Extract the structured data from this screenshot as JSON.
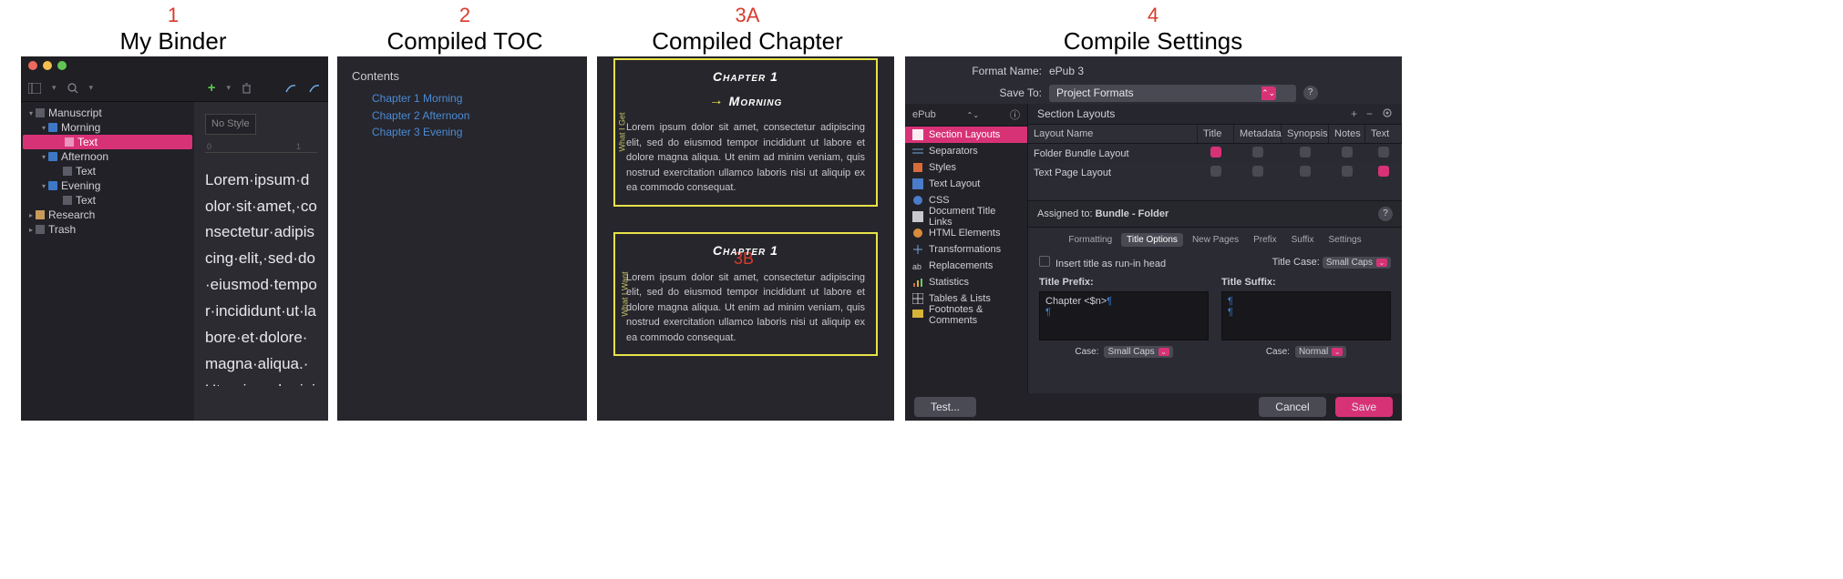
{
  "labels": {
    "l1_num": "1",
    "l1_txt": "My Binder",
    "l2_num": "2",
    "l2_txt": "Compiled TOC",
    "l3_num": "3A",
    "l3_txt": "Compiled Chapter",
    "l3b_num": "3B",
    "l4_num": "4",
    "l4_txt": "Compile Settings"
  },
  "binder": {
    "traffic": {
      "red": "#ec6a5e",
      "yellow": "#f5bf4f",
      "green": "#61c554"
    },
    "tree": {
      "manuscript": "Manuscript",
      "morning": "Morning",
      "text": "Text",
      "afternoon": "Afternoon",
      "evening": "Evening",
      "research": "Research",
      "trash": "Trash"
    },
    "editor": {
      "nostyle": "No Style",
      "ruler0": "0",
      "ruler1": "1",
      "body": "Lorem·ipsum·dolor·sit·amet,·consectetur·adipiscing·elit,·sed·do·eiusmod·tempor·incididunt·ut·labore·et·dolore·magna·aliqua.·Ut·enim·ad·minim·veniam,·quis·nostrud·exercitation·ullamco·laboris·nisi·ut·aliquip·ex·ea·commodo·consequat."
    }
  },
  "toc": {
    "title": "Contents",
    "items": [
      "Chapter 1 Morning",
      "Chapter 2 Afternoon",
      "Chapter 3 Evening"
    ]
  },
  "chapter": {
    "seg1_label": "What I Get",
    "seg2_label": "What I Want",
    "ch_title": "Chapter 1",
    "ch_sub": "Morning",
    "lorem": "Lorem ipsum dolor sit amet, consectetur adipiscing elit, sed do eiusmod tempor incididunt ut labore et dolore magna aliqua. Ut enim ad minim veniam, quis nostrud exercitation ullamco laboris nisi ut aliquip ex ea commodo consequat."
  },
  "compile": {
    "format_name_lbl": "Format Name:",
    "format_name_val": "ePub 3",
    "save_to_lbl": "Save To:",
    "save_to_val": "Project Formats",
    "epub_sel": "ePub",
    "options": [
      "Section Layouts",
      "Separators",
      "Styles",
      "Text Layout",
      "CSS",
      "Document Title Links",
      "HTML Elements",
      "Transformations",
      "Replacements",
      "Statistics",
      "Tables & Lists",
      "Footnotes & Comments"
    ],
    "section_layouts_lbl": "Section Layouts",
    "table": {
      "headers": [
        "Layout Name",
        "Title",
        "Metadata",
        "Synopsis",
        "Notes",
        "Text"
      ],
      "rows": [
        {
          "name": "Folder Bundle Layout",
          "title": true,
          "metadata": false,
          "synopsis": false,
          "notes": false,
          "text": false
        },
        {
          "name": "Text Page Layout",
          "title": false,
          "metadata": false,
          "synopsis": false,
          "notes": false,
          "text": true
        }
      ]
    },
    "assigned_lbl": "Assigned to:",
    "assigned_val": "Bundle - Folder",
    "tabs": [
      "Formatting",
      "Title Options",
      "New Pages",
      "Prefix",
      "Suffix",
      "Settings"
    ],
    "runin_lbl": "Insert title as run-in head",
    "title_case_lbl": "Title Case:",
    "title_case_val": "Small Caps",
    "prefix_lbl": "Title Prefix:",
    "suffix_lbl": "Title Suffix:",
    "prefix_val": "Chapter <$n>",
    "pilcrow": "¶",
    "case_lbl": "Case:",
    "case_prefix_val": "Small Caps",
    "case_suffix_val": "Normal",
    "test_btn": "Test...",
    "cancel_btn": "Cancel",
    "save_btn": "Save",
    "help": "?"
  }
}
